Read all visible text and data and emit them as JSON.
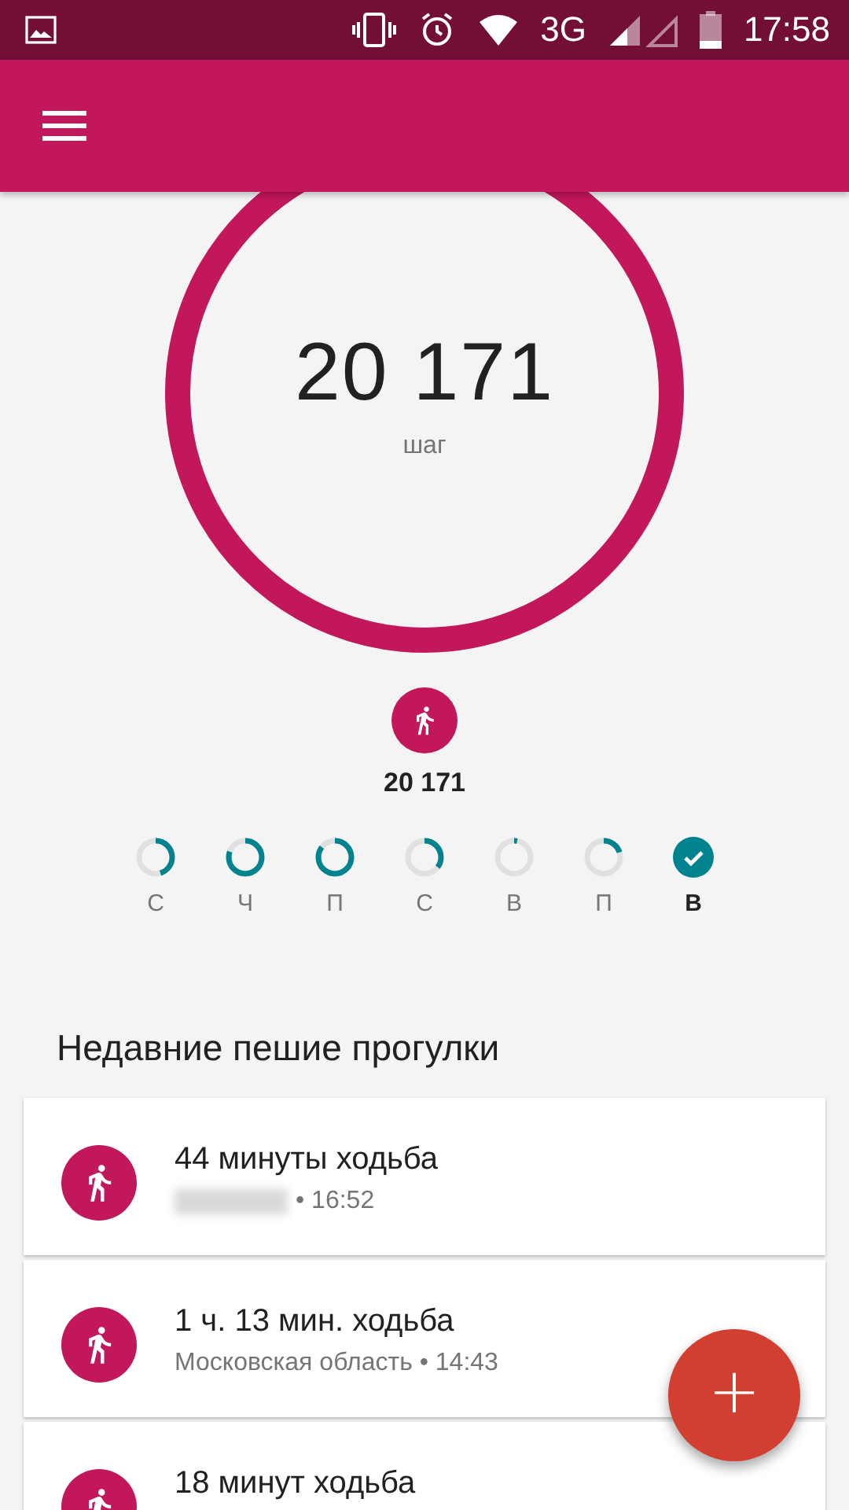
{
  "status_bar": {
    "network": "3G",
    "time": "17:58"
  },
  "goal_ring": {
    "steps": "20 171",
    "unit": "шаг"
  },
  "today": {
    "steps": "20 171"
  },
  "week": [
    {
      "label": "С",
      "done": false,
      "selected": false
    },
    {
      "label": "Ч",
      "done": false,
      "selected": false
    },
    {
      "label": "П",
      "done": false,
      "selected": false
    },
    {
      "label": "С",
      "done": false,
      "selected": false
    },
    {
      "label": "В",
      "done": false,
      "selected": false
    },
    {
      "label": "П",
      "done": false,
      "selected": false
    },
    {
      "label": "В",
      "done": true,
      "selected": true
    }
  ],
  "recent": {
    "title": "Недавние пешие прогулки",
    "items": [
      {
        "title": "44 минуты ходьба",
        "location_hidden": true,
        "subtitle": "• 16:52"
      },
      {
        "title": "1 ч. 13 мин. ходьба",
        "location_hidden": false,
        "subtitle": "Московская область • 14:43"
      },
      {
        "title": "18 минут ходьба",
        "location_hidden": false
      }
    ]
  },
  "fab": {
    "label": "+"
  }
}
